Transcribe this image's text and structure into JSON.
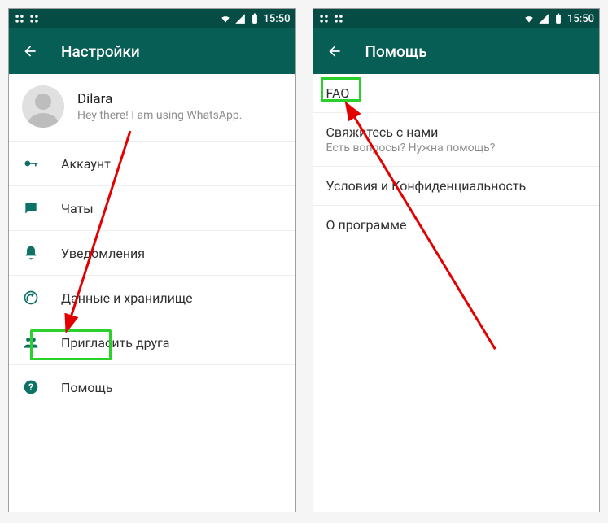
{
  "status": {
    "time": "15:50"
  },
  "left": {
    "title": "Настройки",
    "profile": {
      "name": "Dilara",
      "status": "Hey there! I am using WhatsApp."
    },
    "menu": {
      "account": "Аккаунт",
      "chats": "Чаты",
      "notifications": "Уведомления",
      "data": "Данные и хранилище",
      "invite": "Пригласить друга",
      "help": "Помощь"
    }
  },
  "right": {
    "title": "Помощь",
    "items": {
      "faq": "FAQ",
      "contact_label": "Свяжитесь с нами",
      "contact_sub": "Есть вопросы? Нужна помощь?",
      "terms": "Условия и Конфиденциальность",
      "about": "О программе"
    }
  }
}
